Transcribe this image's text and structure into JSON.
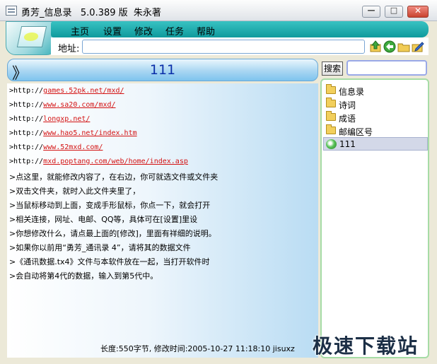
{
  "window": {
    "title": "勇芳_信息录   5.0.389 版  朱永著",
    "minimize_glyph": "—",
    "maximize_glyph": "□",
    "close_glyph": "✕"
  },
  "menu": {
    "items": [
      "主页",
      "设置",
      "修改",
      "任务",
      "帮助"
    ]
  },
  "address": {
    "label": "地址:",
    "value": ""
  },
  "toolbar_icons": [
    "up-folder-icon",
    "back-icon",
    "folder-icon",
    "edit-icon"
  ],
  "header": {
    "chevron": "》",
    "title": "111"
  },
  "search": {
    "button_label": "搜索",
    "value": ""
  },
  "content": {
    "url_lines": [
      {
        "prefix": ">http://",
        "link": "games.52pk.net/mxd/"
      },
      {
        "prefix": ">http://",
        "link": "www.sa20.com/mxd/"
      },
      {
        "prefix": ">http://",
        "link": "longxp.net/"
      },
      {
        "prefix": ">http://",
        "link": "www.hao5.net/index.htm"
      },
      {
        "prefix": ">http://",
        "link": "www.52mxd.com/"
      },
      {
        "prefix": ">http://",
        "link": "mxd.poptang.com/web/home/index.asp"
      }
    ],
    "text_lines": [
      ">点这里，就能修改内容了，在右边，你可就选文件或文件夹",
      ">双击文件夹，就时入此文件夹里了，",
      ">当鼠标移动到上面，变成手形鼠标，你点一下，就会打开",
      ">相关连接，网址、电邮、QQ等，具体可在[设置]里设",
      ">你想修改什么，请点最上面的[修改]，里面有祥细的说明。",
      ">如果你以前用“勇芳_通讯录 4”，请将其的数据文件",
      ">《通讯数据.tx4》文件与本软件放在一起，当打开软件时",
      ">会自动将第4代的数据，输入到第5代中。"
    ],
    "footer": "长度:550字节, 修改时间:2005-10-27 11:18:10 jisuxz"
  },
  "tree": {
    "items": [
      {
        "label": "信息录",
        "icon": "folder-icon",
        "selected": false
      },
      {
        "label": "诗词",
        "icon": "folder-icon",
        "selected": false
      },
      {
        "label": "成语",
        "icon": "folder-icon",
        "selected": false
      },
      {
        "label": "邮编区号",
        "icon": "folder-icon",
        "selected": false
      },
      {
        "label": "111",
        "icon": "document-icon",
        "selected": true
      }
    ]
  },
  "watermark": "极速下载站"
}
